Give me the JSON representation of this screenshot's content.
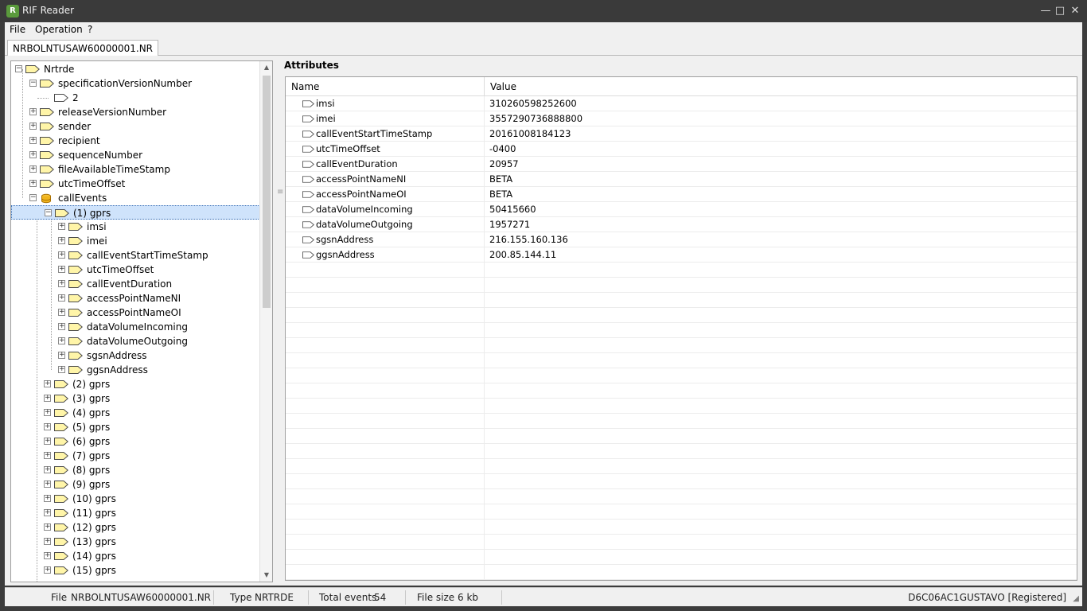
{
  "window": {
    "title": "RIF Reader"
  },
  "menu": {
    "items": [
      "File",
      "Operation",
      "?"
    ]
  },
  "document_tab": {
    "label": "NRBOLNTUSAW60000001.NR"
  },
  "tree": {
    "rows": [
      {
        "label": "Nrtrde"
      },
      {
        "label": "specificationVersionNumber"
      },
      {
        "label": "2"
      },
      {
        "label": "releaseVersionNumber"
      },
      {
        "label": "sender"
      },
      {
        "label": "recipient"
      },
      {
        "label": "sequenceNumber"
      },
      {
        "label": "fileAvailableTimeStamp"
      },
      {
        "label": "utcTimeOffset"
      },
      {
        "label": "callEvents"
      },
      {
        "label": "(1) gprs"
      },
      {
        "label": "imsi"
      },
      {
        "label": "imei"
      },
      {
        "label": "callEventStartTimeStamp"
      },
      {
        "label": "utcTimeOffset"
      },
      {
        "label": "callEventDuration"
      },
      {
        "label": "accessPointNameNI"
      },
      {
        "label": "accessPointNameOI"
      },
      {
        "label": "dataVolumeIncoming"
      },
      {
        "label": "dataVolumeOutgoing"
      },
      {
        "label": "sgsnAddress"
      },
      {
        "label": "ggsnAddress"
      },
      {
        "label": "(2) gprs"
      },
      {
        "label": "(3) gprs"
      },
      {
        "label": "(4) gprs"
      },
      {
        "label": "(5) gprs"
      },
      {
        "label": "(6) gprs"
      },
      {
        "label": "(7) gprs"
      },
      {
        "label": "(8) gprs"
      },
      {
        "label": "(9) gprs"
      },
      {
        "label": "(10) gprs"
      },
      {
        "label": "(11) gprs"
      },
      {
        "label": "(12) gprs"
      },
      {
        "label": "(13) gprs"
      },
      {
        "label": "(14) gprs"
      },
      {
        "label": "(15) gprs"
      }
    ]
  },
  "attributes": {
    "title": "Attributes",
    "columns": [
      "Name",
      "Value"
    ],
    "rows": [
      {
        "name": "imsi",
        "value": "310260598252600"
      },
      {
        "name": "imei",
        "value": "3557290736888800"
      },
      {
        "name": "callEventStartTimeStamp",
        "value": "20161008184123"
      },
      {
        "name": "utcTimeOffset",
        "value": "-0400"
      },
      {
        "name": "callEventDuration",
        "value": "20957"
      },
      {
        "name": "accessPointNameNI",
        "value": "BETA"
      },
      {
        "name": "accessPointNameOI",
        "value": "BETA"
      },
      {
        "name": "dataVolumeIncoming",
        "value": "50415660"
      },
      {
        "name": "dataVolumeOutgoing",
        "value": "1957271"
      },
      {
        "name": "sgsnAddress",
        "value": "216.155.160.136"
      },
      {
        "name": "ggsnAddress",
        "value": "200.85.144.11"
      }
    ]
  },
  "status": {
    "file_label": "File",
    "file_value": "NRBOLNTUSAW60000001.NR",
    "type_label": "Type",
    "type_value": "NRTRDE",
    "events_label": "Total events",
    "events_value": "54",
    "size_label": "File size",
    "size_value": "6 kb",
    "registration": "D6C06AC1GUSTAVO [Registered]"
  },
  "icons": {
    "tag": "tag-icon",
    "database": "database-icon",
    "app": "app-icon"
  },
  "colors": {
    "tag_fill": "#fff5a8",
    "selection": "#cfe3fb",
    "titlebar": "#3a3a3a"
  }
}
